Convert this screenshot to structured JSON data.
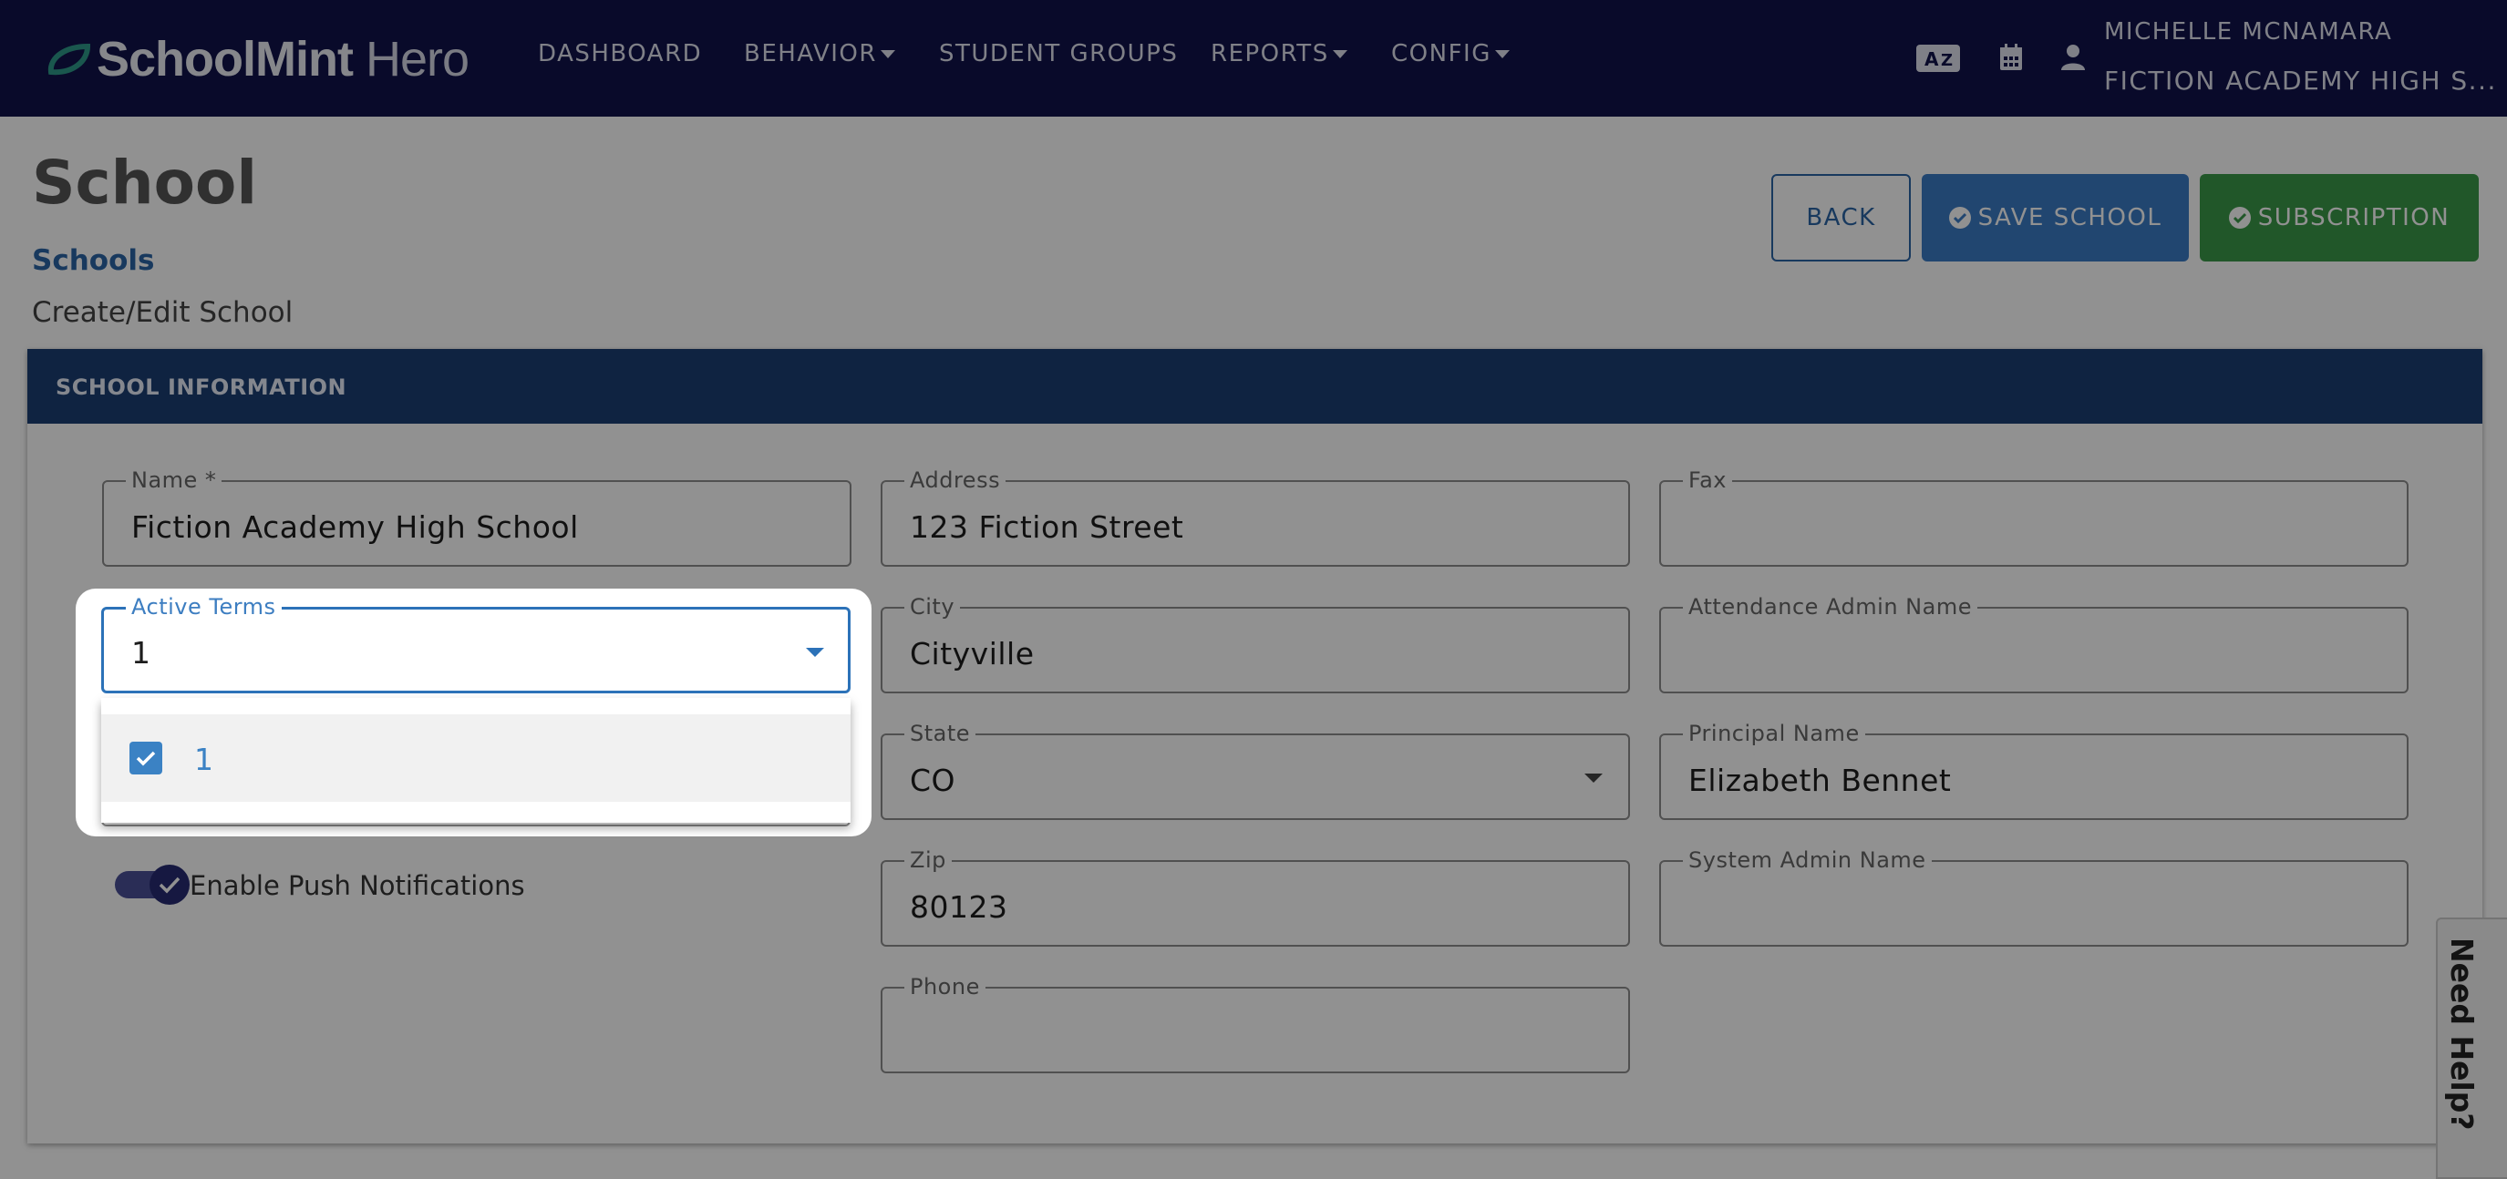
{
  "brand": {
    "name_bold": "SchoolMint",
    "name_light": " Hero"
  },
  "nav": {
    "items": [
      {
        "label": "DASHBOARD",
        "dropdown": false
      },
      {
        "label": "BEHAVIOR",
        "dropdown": true
      },
      {
        "label": "STUDENT GROUPS",
        "dropdown": false
      },
      {
        "label": "REPORTS",
        "dropdown": true
      },
      {
        "label": "CONFIG",
        "dropdown": true
      }
    ],
    "icons": [
      "translate-icon",
      "calendar-icon",
      "user-icon"
    ],
    "user_name": "MICHELLE MCNAMARA",
    "school_name": "FICTION ACADEMY HIGH S..."
  },
  "page": {
    "title": "School",
    "breadcrumb_link": "Schools",
    "breadcrumb_current": "Create/Edit School"
  },
  "actions": {
    "back": "BACK",
    "save": "SAVE SCHOOL",
    "subscription": "SUBSCRIPTION"
  },
  "card": {
    "title": "SCHOOL INFORMATION"
  },
  "fields": {
    "name": {
      "label": "Name *",
      "value": "Fiction Academy High School"
    },
    "active_terms": {
      "label": "Active Terms",
      "value": "1"
    },
    "address": {
      "label": "Address",
      "value": "123 Fiction Street"
    },
    "city": {
      "label": "City",
      "value": "Cityville"
    },
    "state": {
      "label": "State",
      "value": "CO"
    },
    "zip": {
      "label": "Zip",
      "value": "80123"
    },
    "phone": {
      "label": "Phone",
      "value": ""
    },
    "fax": {
      "label": "Fax",
      "value": ""
    },
    "attendance_admin": {
      "label": "Attendance Admin Name",
      "value": ""
    },
    "principal": {
      "label": "Principal Name",
      "value": "Elizabeth Bennet"
    },
    "system_admin": {
      "label": "System Admin Name",
      "value": ""
    }
  },
  "toggle": {
    "label": "Enable Push Notifications",
    "on": true
  },
  "dropdown": {
    "options": [
      {
        "label": "1",
        "checked": true
      }
    ]
  },
  "help": {
    "label": "Need Help?"
  },
  "colors": {
    "nav_bg": "#10124a",
    "card_header": "#1b3f72",
    "primary": "#3b7cc6",
    "success": "#3a9a49",
    "link": "#2b64a5"
  }
}
